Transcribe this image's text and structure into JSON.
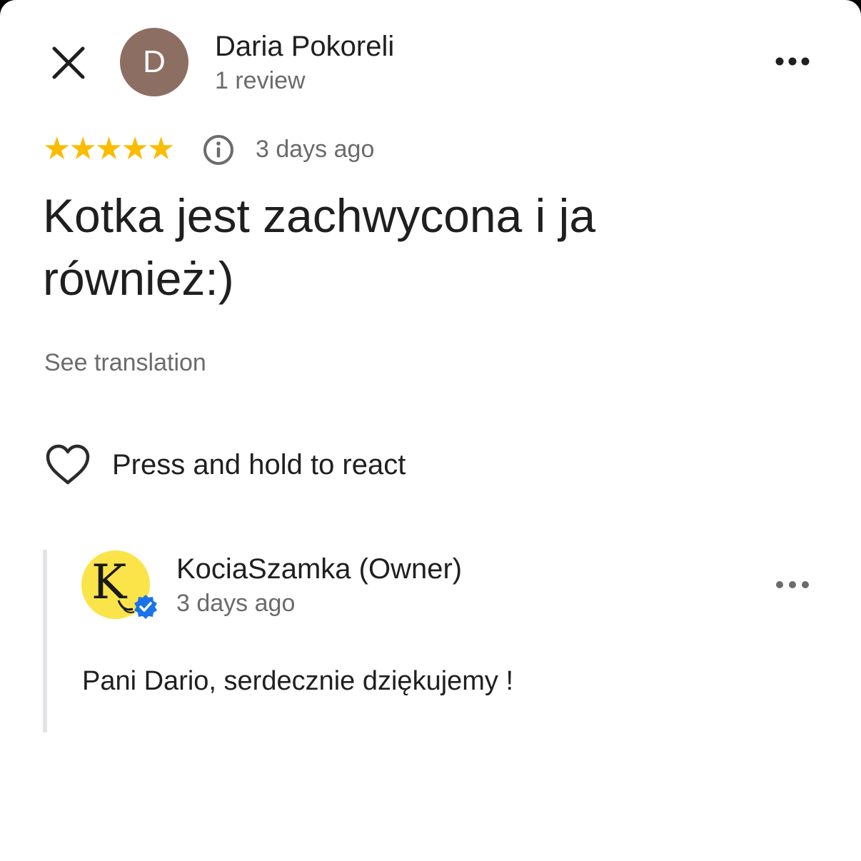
{
  "review": {
    "author": {
      "initial": "D",
      "name": "Daria Pokoreli",
      "meta": "1 review",
      "avatar_color": "#8d6e63"
    },
    "rating": 5,
    "rating_max": 5,
    "star_color": "#fbbc04",
    "date": "3 days ago",
    "text": "Kotka jest zachwycona i ja również:)",
    "see_translation_label": "See translation",
    "react_label": "Press and hold to react"
  },
  "owner_reply": {
    "avatar_letter": "K",
    "avatar_color": "#fbe44a",
    "verified_color": "#1a73e8",
    "name": "KociaSzamka (Owner)",
    "date": "3 days ago",
    "text": "Pani Dario, serdecznie dziękujemy !"
  },
  "icons": {
    "close": "close-icon",
    "more": "more-horizontal-icon",
    "info": "info-icon",
    "heart": "heart-outline-icon",
    "verified": "verified-badge-icon"
  }
}
